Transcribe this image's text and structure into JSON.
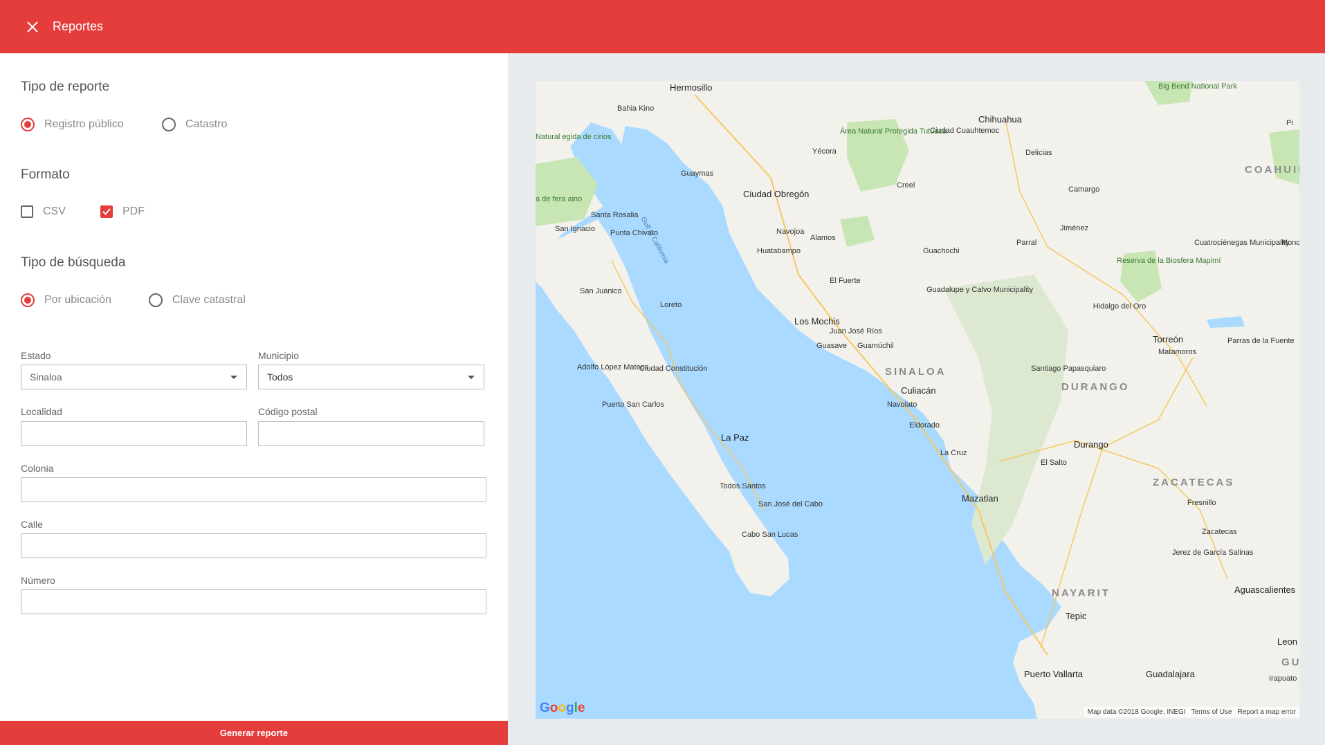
{
  "app_bar": {
    "title": "Reportes",
    "close_icon": "close-icon"
  },
  "report_type": {
    "title": "Tipo de reporte",
    "options": [
      {
        "label": "Registro público",
        "selected": true
      },
      {
        "label": "Catastro",
        "selected": false
      }
    ]
  },
  "format": {
    "title": "Formato",
    "options": [
      {
        "label": "CSV",
        "checked": false
      },
      {
        "label": "PDF",
        "checked": true
      }
    ]
  },
  "search_type": {
    "title": "Tipo de búsqueda",
    "options": [
      {
        "label": "Por ubicación",
        "selected": true
      },
      {
        "label": "Clave catastral",
        "selected": false
      }
    ]
  },
  "form": {
    "estado": {
      "label": "Estado",
      "value": "Sinaloa"
    },
    "municipio": {
      "label": "Municipio",
      "value": "Todos"
    },
    "localidad": {
      "label": "Localidad",
      "value": ""
    },
    "codigo_postal": {
      "label": "Código postal",
      "value": ""
    },
    "colonia": {
      "label": "Colonia",
      "value": ""
    },
    "calle": {
      "label": "Calle",
      "value": ""
    },
    "numero": {
      "label": "Número",
      "value": ""
    }
  },
  "generate_button": {
    "label": "Generar reporte"
  },
  "colors": {
    "accent": "#e53c3c",
    "water": "#aadaff",
    "land": "#f2f1ec",
    "park": "#c8e6b4"
  },
  "map": {
    "labels": {
      "hermosillo": "Hermosillo",
      "bahia_kino": "Bahia Kino",
      "chihuahua": "Chihuahua",
      "ciudad_cuauhtemoc": "Ciudad Cuauhtemoc",
      "area_tutuaca": "Área Natural Protegida Tutuaca",
      "yecora": "Yécora",
      "delicias": "Delicias",
      "guaymas": "Guaymas",
      "ciudad_obregon": "Ciudad Obregón",
      "creel": "Creel",
      "camargo": "Camargo",
      "coahuila": "COAHUIL",
      "big_bend": "Big Bend National Park",
      "santa_rosalia": "Santa Rosalia",
      "san_ignacio": "San Ignacio",
      "punta_chivato": "Punta Chivato",
      "gulf_of_california": "Gulf of California",
      "navojoa": "Navojoa",
      "alamos": "Alamos",
      "jimenez": "Jiménez",
      "huatabampo": "Huatabampo",
      "guachochi": "Guachochi",
      "parral": "Parral",
      "reserva_mapimi": "Reserva de la Biosfera Mapimí",
      "cuatrocienegas": "Cuatrociénegas Municipality",
      "san_juanico": "San Juanico",
      "loreto": "Loreto",
      "el_fuerte": "El Fuerte",
      "guadalupe_calvo": "Guadalupe y Calvo Municipality",
      "los_mochis": "Los Mochis",
      "juan_jose_rios": "Juan José Ríos",
      "guasave": "Guasave",
      "guamuchil": "Guamúchil",
      "el_oro": "Hidalgo del Oro",
      "torreon": "Torreón",
      "matamoros": "Matamoros",
      "parras": "Parras de la Fuente",
      "adolfo_lopez_mateos": "Adolfo López Mateos",
      "ciudad_constitucion": "Ciudad Constitución",
      "sinaloa": "SINALOA",
      "santiago_papasquiaro": "Santiago Papasquiaro",
      "durango_state": "DURANGO",
      "culiacan": "Culiacán",
      "navolato": "Navolato",
      "puerto_san_carlos": "Puerto San Carlos",
      "eldorado": "Eldorado",
      "la_paz": "La Paz",
      "la_cruz": "La Cruz",
      "durango": "Durango",
      "el_salto": "El Salto",
      "todos_santos": "Todos Santos",
      "mazatlan": "Mazatlan",
      "zacatecas_state": "ZACATECAS",
      "san_jose_cabo": "San José del Cabo",
      "fresnillo": "Fresnillo",
      "cabo_san_lucas": "Cabo San Lucas",
      "zacatecas": "Zacatecas",
      "jerez": "Jerez de García Salinas",
      "nayarit": "NAYARIT",
      "aguascalientes": "Aguascalientes",
      "tepic": "Tepic",
      "leon": "Leon",
      "guanajuato": "GUAN",
      "puerto_vallarta": "Puerto Vallarta",
      "guadalajara": "Guadalajara",
      "irapuato": "Irapuato",
      "monclova": "Monc",
      "reserva_left": "Natural egida de cirios",
      "sierra_left": "a de fera aino",
      "pi": "Pi"
    },
    "attribution": {
      "data": "Map data ©2018 Google, INEGI",
      "terms": "Terms of Use",
      "report": "Report a map error"
    }
  }
}
